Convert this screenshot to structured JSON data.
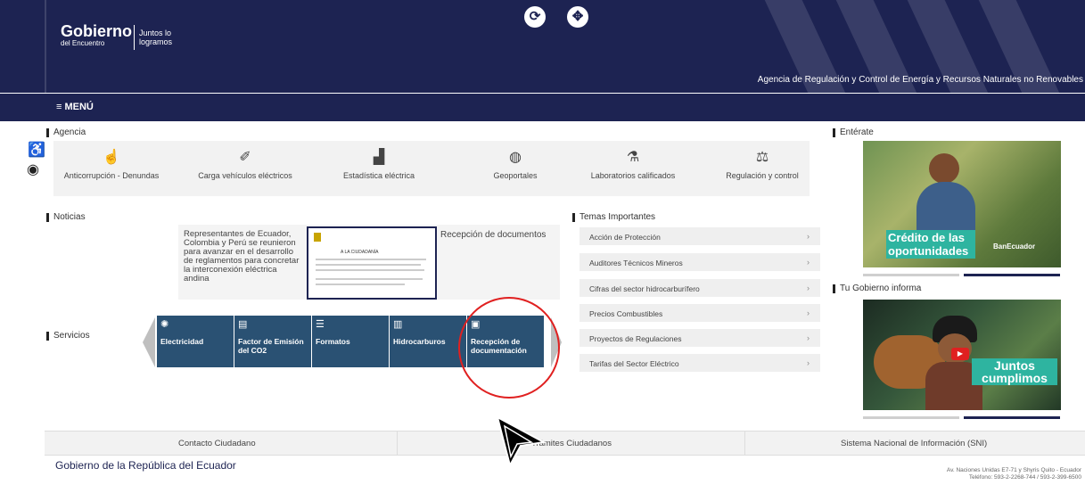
{
  "header": {
    "logo_brand": "Gobierno",
    "logo_sub": "del Encuentro",
    "logo_slogan": "Juntos lo logramos",
    "agency_name": "Agencia de Regulación y Control de Energía y Recursos Naturales no Renovables"
  },
  "menu": {
    "label": "≡ MENÚ"
  },
  "agency": {
    "title": "Agencia",
    "items": [
      {
        "label": "Anticorrupción - Denundas",
        "icon": "hand-icon"
      },
      {
        "label": "Carga vehículos eléctricos",
        "icon": "plug-icon"
      },
      {
        "label": "Estadística eléctrica",
        "icon": "chart-icon"
      },
      {
        "label": "Geoportales",
        "icon": "globe-icon"
      },
      {
        "label": "Laboratorios calificados",
        "icon": "flask-icon"
      },
      {
        "label": "Regulación y control",
        "icon": "scale-icon"
      }
    ]
  },
  "news": {
    "title": "Noticias",
    "headline": "Representantes de Ecuador, Colombia y Perú se reunieron para avanzar en el desarrollo de reglamentos para concretar la interconexión eléctrica andina",
    "thumb_title": "A LA CIUDADANÍA",
    "caption": "Recepción de documentos"
  },
  "services": {
    "title": "Servicios",
    "items": [
      {
        "label": "Electricidad",
        "icon": "bulb-icon"
      },
      {
        "label": "Factor de Emisión del CO2",
        "icon": "document-icon"
      },
      {
        "label": "Formatos",
        "icon": "list-icon"
      },
      {
        "label": "Hidrocarburos",
        "icon": "barrel-icon"
      },
      {
        "label": "Recepción de documentación",
        "icon": "file-icon"
      }
    ]
  },
  "topics": {
    "title": "Temas Importantes",
    "items": [
      "Acción de Protección",
      "Auditores Técnicos Mineros",
      "Cifras del sector hidrocarburífero",
      "Precios Combustibles",
      "Proyectos de Regulaciones",
      "Tarifas del Sector Eléctrico"
    ]
  },
  "enterate": {
    "title": "Entérate",
    "promo_text": "Crédito de las oportunidades",
    "promo_brand": "BanEcuador"
  },
  "gobierno_informa": {
    "title": "Tu Gobierno informa",
    "promo_text": "Juntos cumplimos"
  },
  "footer": {
    "links": [
      "Contacto Ciudadano",
      "Trámites Ciudadanos",
      "Sistema Nacional de Información (SNI)"
    ],
    "gov_title": "Gobierno de la República del Ecuador",
    "address_1": "Av. Naciones Unidas E7-71 y Shyris Quito - Ecuador",
    "address_2": "Teléfono: 593-2-2268-744 / 593-2-399-6500"
  },
  "colors": {
    "navy": "#1d2352",
    "service_blue": "#2a5173",
    "annotation_red": "#e02020"
  }
}
